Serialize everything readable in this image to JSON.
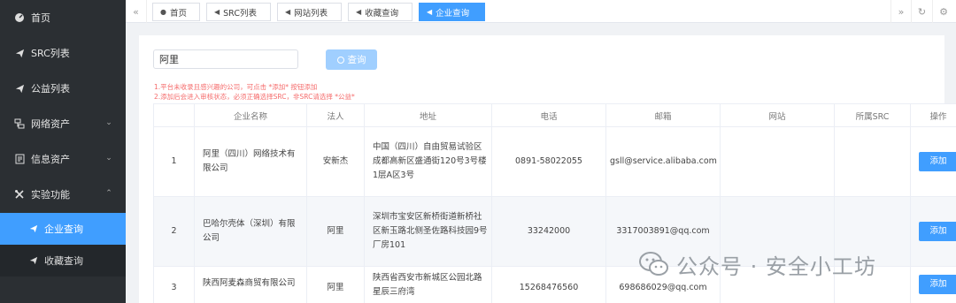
{
  "sidebar": {
    "items": [
      {
        "label": "首页",
        "icon": "dashboard-icon"
      },
      {
        "label": "SRC列表",
        "icon": "send-icon"
      },
      {
        "label": "公益列表",
        "icon": "send-icon"
      },
      {
        "label": "网络资产",
        "icon": "network-icon"
      },
      {
        "label": "信息资产",
        "icon": "document-icon"
      },
      {
        "label": "实验功能",
        "icon": "tools-icon"
      }
    ],
    "sub_items": [
      {
        "label": "企业查询",
        "active": true
      },
      {
        "label": "收藏查询",
        "active": false
      }
    ]
  },
  "tabs": [
    {
      "label": "首页",
      "active": false
    },
    {
      "label": "SRC列表",
      "active": false
    },
    {
      "label": "网站列表",
      "active": false
    },
    {
      "label": "收藏查询",
      "active": false
    },
    {
      "label": "企业查询",
      "active": true
    }
  ],
  "search": {
    "value": "阿里",
    "button_label": "查询"
  },
  "notice": {
    "line1": "1.平台未收录且感兴趣的公司，可点击 *添加* 按钮添加",
    "line2": "2.添加后会进入审核状态，必须正确选择SRC，非SRC请选择 *公益*"
  },
  "table": {
    "columns": [
      "",
      "企业名称",
      "法人",
      "地址",
      "电话",
      "邮箱",
      "网站",
      "所属SRC",
      "操作"
    ],
    "action_label": "添加",
    "rows": [
      {
        "index": "1",
        "name": "阿里（四川）网络技术有限公司",
        "legal": "安新杰",
        "address": "中国（四川）自由贸易试验区成都高新区盛通街120号3号楼1层A区3号",
        "phone": "0891-58022055",
        "email": "gsll@service.alibaba.com",
        "website": "",
        "src": ""
      },
      {
        "index": "2",
        "name": "巴哈尔壳体（深圳）有限公司",
        "legal": "阿里",
        "address": "深圳市宝安区新桥街道新桥社区新玉路北侧圣佐路科技园9号厂房101",
        "phone": "33242000",
        "email": "3317003891@qq.com",
        "website": "",
        "src": ""
      },
      {
        "index": "3",
        "name": "陕西阿麦森商贸有限公司",
        "legal": "阿里",
        "address": "陕西省西安市新城区公园北路星辰三府湾",
        "phone": "15268476560",
        "email": "698686029@qq.com",
        "website": "",
        "src": ""
      }
    ]
  },
  "watermark": {
    "text": "公众号 · 安全小工坊"
  },
  "colors": {
    "accent": "#409eff",
    "sidebar_bg": "#2b2f33",
    "notice": "#f56c6c"
  }
}
